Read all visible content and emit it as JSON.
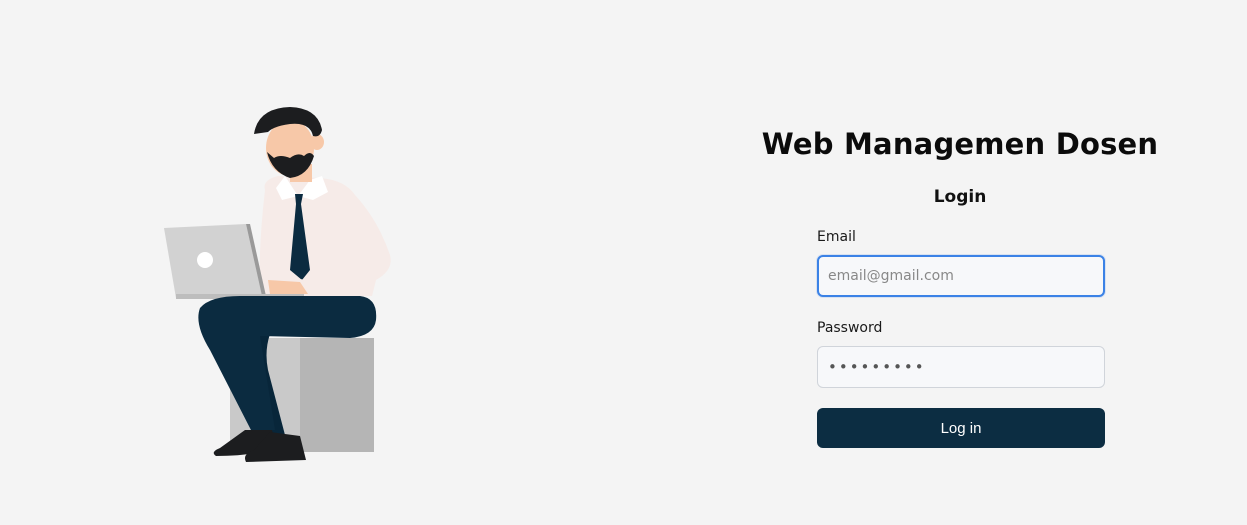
{
  "app": {
    "title": "Web Managemen Dosen"
  },
  "login": {
    "heading": "Login",
    "email_label": "Email",
    "email_placeholder": "email@gmail.com",
    "email_value": "",
    "password_label": "Password",
    "password_value": "•••••••••",
    "submit_label": "Log in"
  },
  "colors": {
    "background": "#f4f4f4",
    "button_bg": "#0c2d42",
    "focus_border": "#3b82e6",
    "pants": "#0b2b40",
    "tie": "#0b2b40",
    "shirt": "#f6ebe8",
    "skin": "#f7c8a8",
    "hair": "#1c1d1f",
    "seat": "#b5b5b5",
    "laptop": "#d2d2d2"
  },
  "illustration": {
    "name": "man-with-laptop-illustration"
  }
}
